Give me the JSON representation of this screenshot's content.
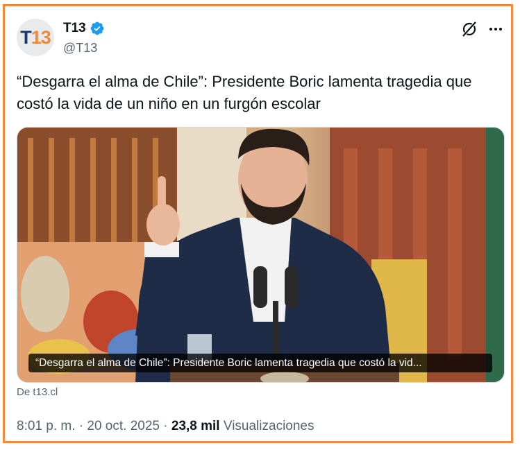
{
  "account": {
    "display_name": "T13",
    "handle": "@T13",
    "avatar_text_a": "T",
    "avatar_text_b": "13",
    "verified": true,
    "avatar_colors": {
      "letter": "#1b3a67",
      "number": "#f2883a"
    }
  },
  "tweet": {
    "text": "“Desgarra el alma de Chile”: Presidente Boric lamenta tragedia que costó la vida de un niño en un furgón escolar"
  },
  "card": {
    "title": "“Desgarra el alma de Chile”: Presidente Boric lamenta tragedia que costó la vid...",
    "source": "De t13.cl"
  },
  "meta": {
    "time": "8:01 p. m.",
    "separator": "·",
    "date": "20 oct. 2025",
    "views_count": "23,8 mil",
    "views_label": "Visualizaciones"
  },
  "icons": {
    "grok": "grok-icon",
    "more": "more-icon",
    "verified": "verified-badge-icon"
  },
  "colors": {
    "border": "#f2883a",
    "text_primary": "#0f1419",
    "text_secondary": "#536471",
    "verified_blue": "#1d9bf0"
  }
}
